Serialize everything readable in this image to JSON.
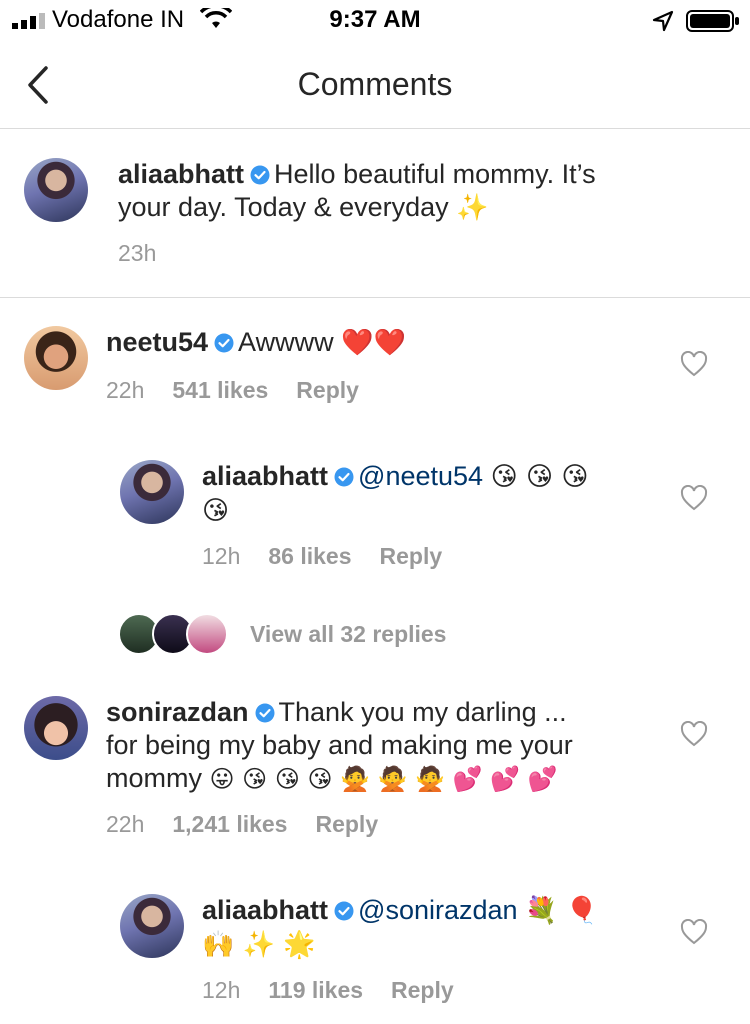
{
  "status_bar": {
    "carrier": "Vodafone IN",
    "time": "9:37 AM"
  },
  "nav": {
    "title": "Comments"
  },
  "caption": {
    "username": "aliaabhatt",
    "text_line1": "Hello beautiful mommy. It’s",
    "text_line2": "your day. Today & everyday",
    "emoji": "✨",
    "time": "23h"
  },
  "comments": [
    {
      "username": "neetu54",
      "text": "Awwww",
      "emoji": "❤️❤️",
      "time": "22h",
      "likes": "541 likes",
      "reply_label": "Reply",
      "replies": [
        {
          "username": "aliaabhatt",
          "mention": "@neetu54",
          "emoji_line1": "😘 😘 😘",
          "emoji_line2": "😘",
          "time": "12h",
          "likes": "86 likes",
          "reply_label": "Reply"
        }
      ],
      "view_replies": "View all 32 replies"
    },
    {
      "username": "sonirazdan",
      "text_line1": "Thank you my darling ...",
      "text_line2": "for being my baby and making me your",
      "text_line3": "mommy",
      "emoji": "😛 😘 😘 😘 🙅 🙅 🙅 💕 💕 💕",
      "time": "22h",
      "likes": "1,241 likes",
      "reply_label": "Reply",
      "replies": [
        {
          "username": "aliaabhatt",
          "mention": "@sonirazdan",
          "emoji_line1": "💐 🎈",
          "emoji_line2": "🙌 ✨ 🌟",
          "time": "12h",
          "likes": "119 likes",
          "reply_label": "Reply"
        }
      ]
    }
  ],
  "colors": {
    "verified_blue": "#3897f0",
    "secondary_text": "#999999",
    "mention_blue": "#003569",
    "divider": "#dbdbdb"
  }
}
